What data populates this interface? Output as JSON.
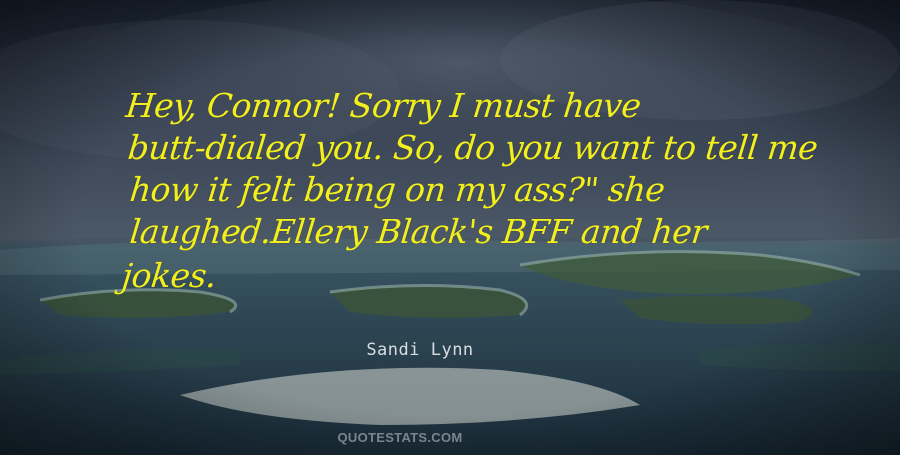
{
  "quote": {
    "lines": [
      "Hey, Connor! Sorry I must have",
      "butt-dialed you. So, do you want to tell me",
      "how it felt being on my ass?\" she",
      "laughed.Ellery Black's BFF and her",
      "jokes."
    ],
    "author": "Sandi Lynn",
    "text_color": "#f2ef1c"
  },
  "watermark": "QUOTESTATS.COM"
}
